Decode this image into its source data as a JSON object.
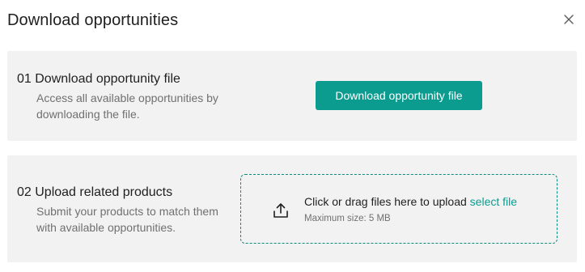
{
  "dialog": {
    "title": "Download opportunities",
    "close_icon": "close-icon"
  },
  "step1": {
    "heading": "01 Download opportunity file",
    "description": "Access all available opportunities by downloading the file.",
    "button_label": "Download opportunity file"
  },
  "step2": {
    "heading": "02 Upload related products",
    "description": "Submit your products to match them with available opportunities.",
    "upload_icon": "upload-icon",
    "drop_text": "Click or drag files here to upload ",
    "select_link": "select file",
    "max_size": "Maximum size: 5 MB"
  },
  "colors": {
    "accent": "#0b9c8f",
    "section_bg": "#f2f2f2",
    "muted_text": "#707070"
  }
}
